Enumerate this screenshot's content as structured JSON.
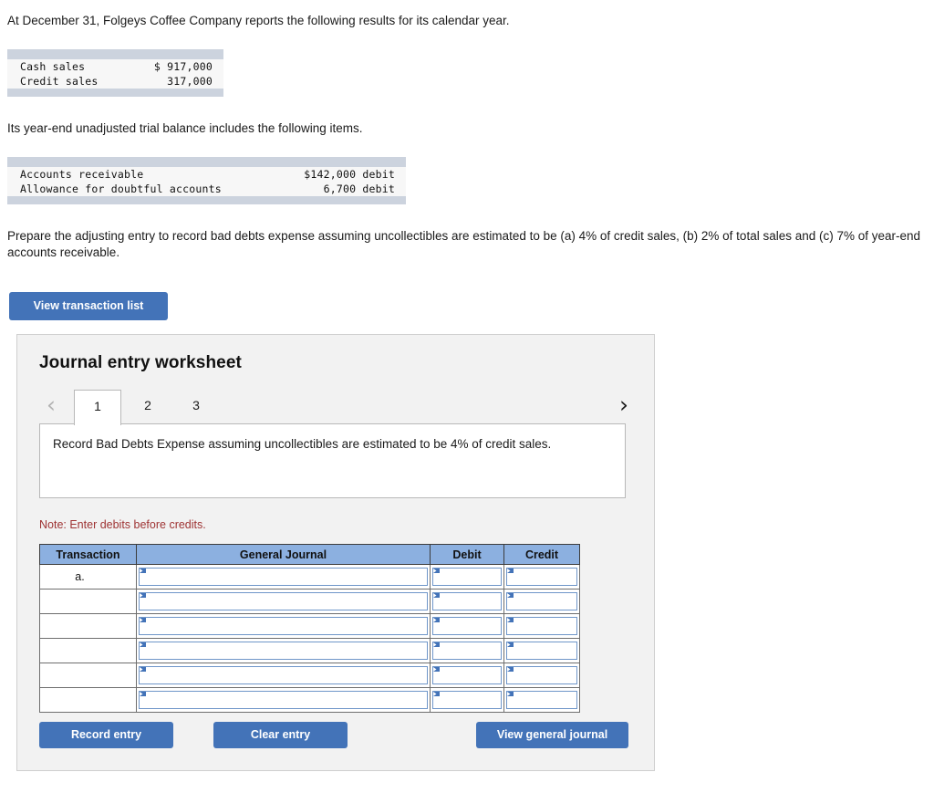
{
  "intro": {
    "paragraph": "At December 31, Folgeys Coffee Company reports the following results for its calendar year."
  },
  "sales_table": {
    "rows": [
      {
        "label": "Cash sales",
        "value": "$ 917,000"
      },
      {
        "label": "Credit sales",
        "value": "317,000"
      }
    ]
  },
  "trial_balance": {
    "paragraph": "Its year-end unadjusted trial balance includes the following items.",
    "rows": [
      {
        "label": "Accounts receivable",
        "value": "$142,000 debit"
      },
      {
        "label": "Allowance for doubtful accounts",
        "value": "6,700 debit"
      }
    ]
  },
  "task": {
    "paragraph": "Prepare the adjusting entry to record bad debts expense assuming uncollectibles are estimated to be (a) 4% of credit sales, (b) 2% of total sales and (c) 7% of year-end accounts receivable."
  },
  "buttons": {
    "view_transaction_list": "View transaction list",
    "record_entry": "Record entry",
    "clear_entry": "Clear entry",
    "view_general_journal": "View general journal"
  },
  "worksheet": {
    "title": "Journal entry worksheet",
    "tabs": [
      {
        "label": "1",
        "active": true
      },
      {
        "label": "2",
        "active": false
      },
      {
        "label": "3",
        "active": false
      }
    ],
    "prev_arrow": "‹",
    "next_arrow": "›",
    "description": "Record Bad Debts Expense assuming uncollectibles are estimated to be 4% of credit sales.",
    "note": "Note: Enter debits before credits.",
    "table": {
      "headers": [
        "Transaction",
        "General Journal",
        "Debit",
        "Credit"
      ],
      "rows": [
        {
          "transaction": "a.",
          "general_journal": "",
          "debit": "",
          "credit": ""
        },
        {
          "transaction": "",
          "general_journal": "",
          "debit": "",
          "credit": ""
        },
        {
          "transaction": "",
          "general_journal": "",
          "debit": "",
          "credit": ""
        },
        {
          "transaction": "",
          "general_journal": "",
          "debit": "",
          "credit": ""
        },
        {
          "transaction": "",
          "general_journal": "",
          "debit": "",
          "credit": ""
        },
        {
          "transaction": "",
          "general_journal": "",
          "debit": "",
          "credit": ""
        }
      ]
    }
  },
  "colors": {
    "accent_blue": "#4373b8",
    "table_header_blue": "#8cb0e0",
    "data_table_band": "#ccd3de",
    "note_red": "#9e3232",
    "panel_bg": "#f2f2f2"
  }
}
